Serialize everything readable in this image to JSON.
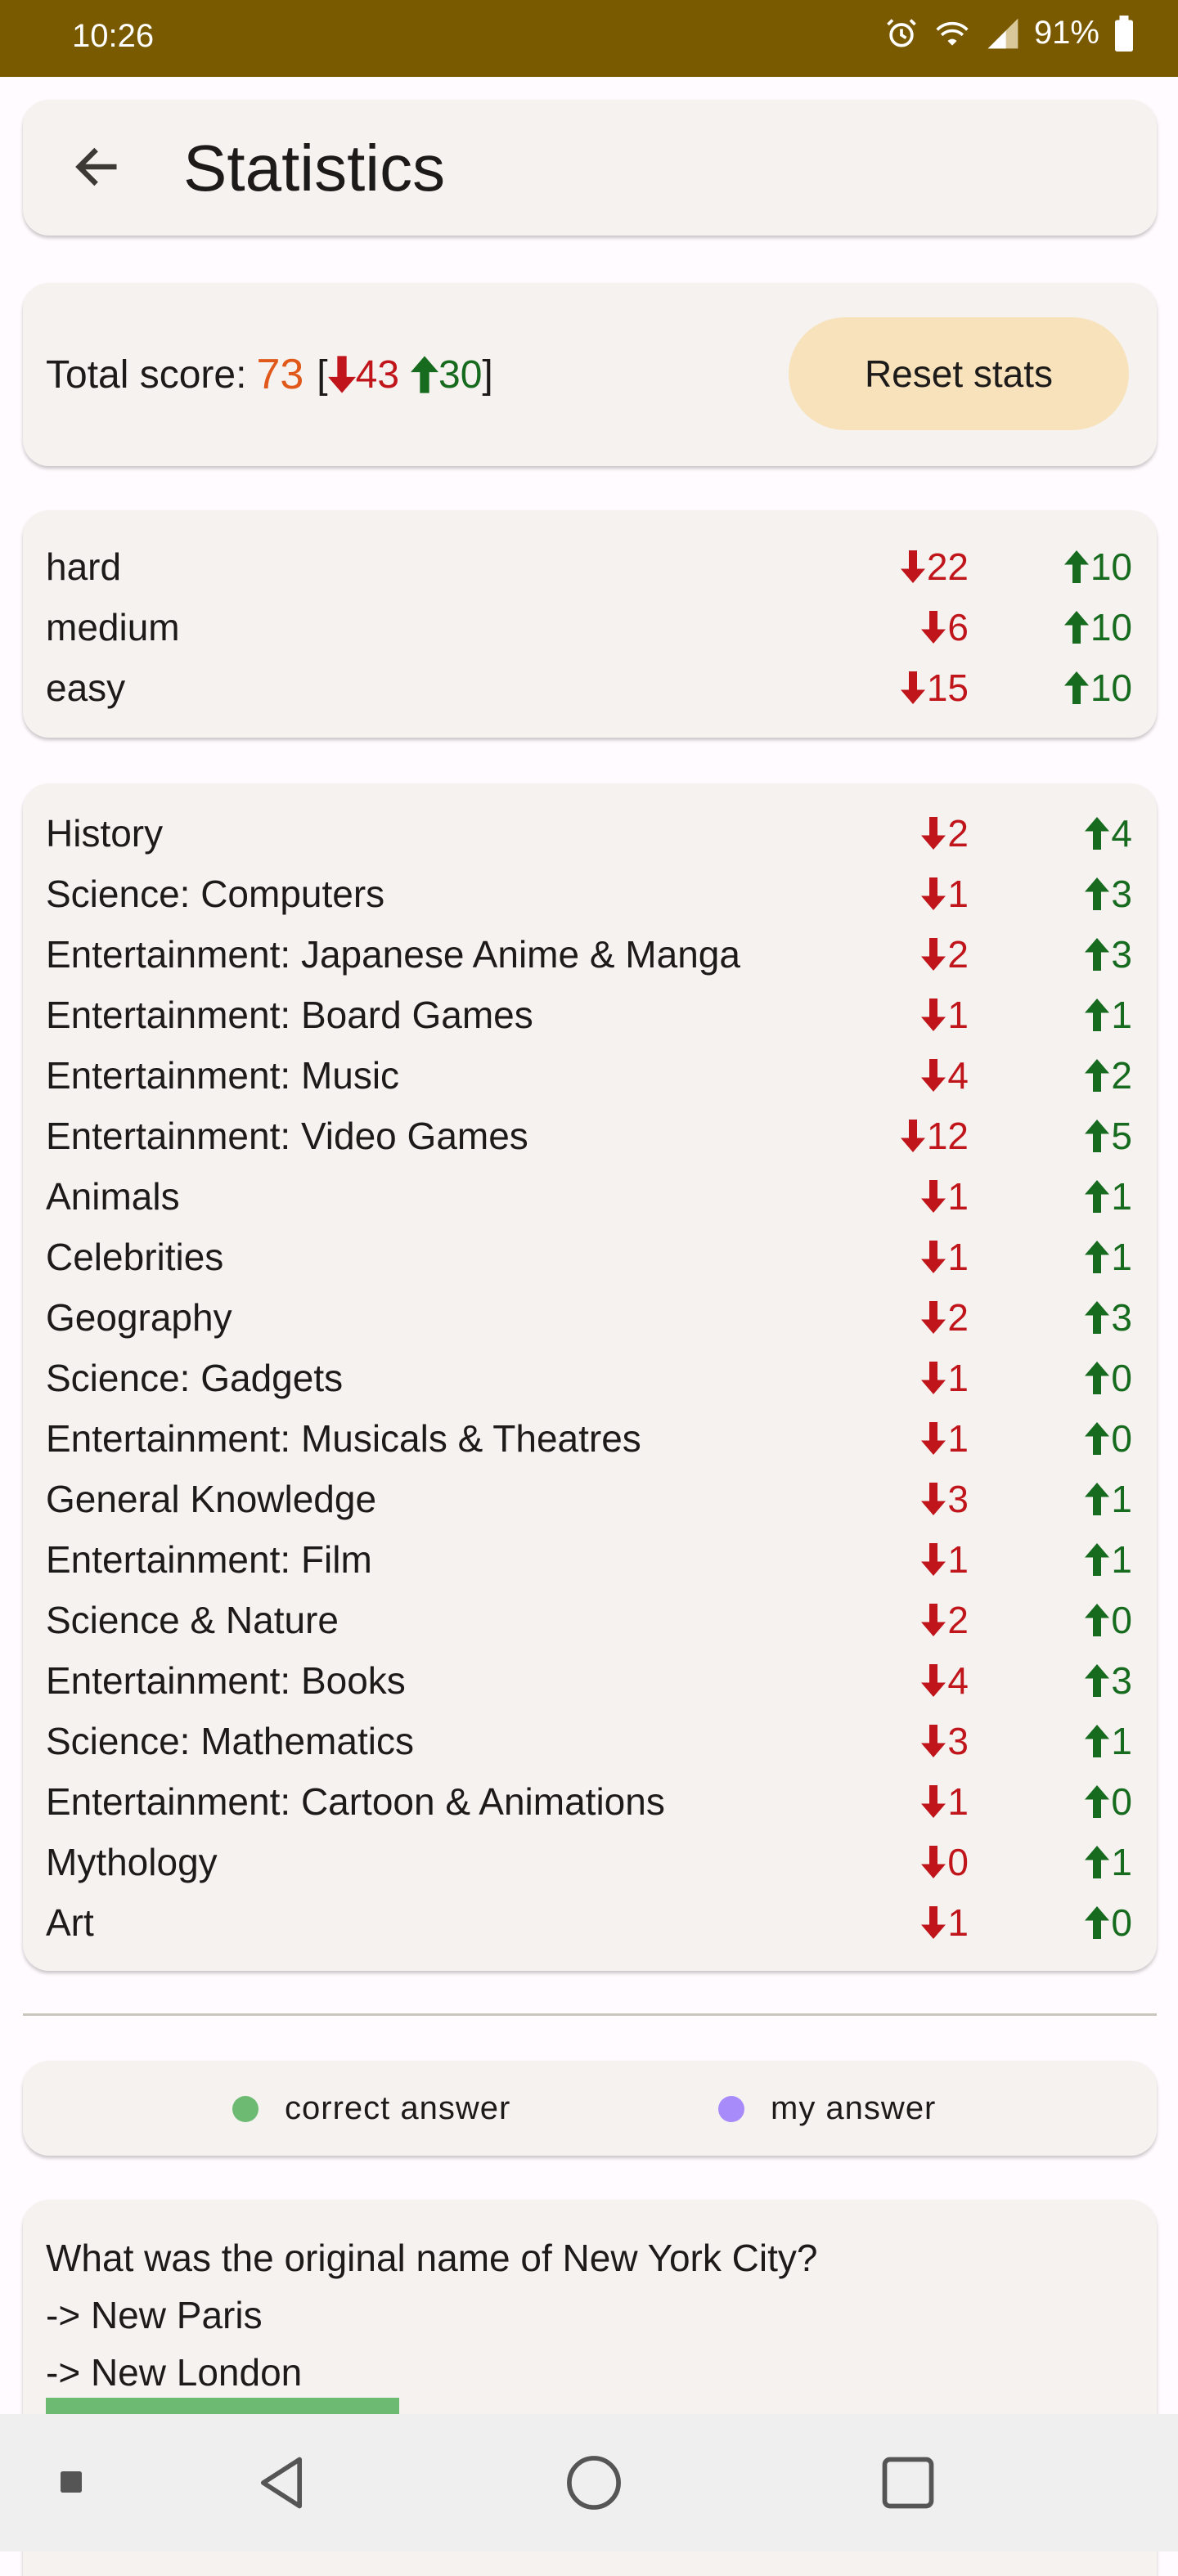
{
  "status_bar": {
    "time": "10:26",
    "battery": "91%"
  },
  "app_bar": {
    "title": "Statistics"
  },
  "score": {
    "label": "Total score:",
    "total": "73",
    "open_bracket": "[",
    "down": "43",
    "up": "30",
    "close_bracket": "]",
    "reset_label": "Reset stats"
  },
  "difficulty": [
    {
      "name": "hard",
      "down": "22",
      "up": "10"
    },
    {
      "name": "medium",
      "down": "6",
      "up": "10"
    },
    {
      "name": "easy",
      "down": "15",
      "up": "10"
    }
  ],
  "categories": [
    {
      "name": "History",
      "down": "2",
      "up": "4"
    },
    {
      "name": "Science: Computers",
      "down": "1",
      "up": "3"
    },
    {
      "name": "Entertainment: Japanese Anime & Manga",
      "down": "2",
      "up": "3"
    },
    {
      "name": "Entertainment: Board Games",
      "down": "1",
      "up": "1"
    },
    {
      "name": "Entertainment: Music",
      "down": "4",
      "up": "2"
    },
    {
      "name": "Entertainment: Video Games",
      "down": "12",
      "up": "5"
    },
    {
      "name": "Animals",
      "down": "1",
      "up": "1"
    },
    {
      "name": "Celebrities",
      "down": "1",
      "up": "1"
    },
    {
      "name": "Geography",
      "down": "2",
      "up": "3"
    },
    {
      "name": "Science: Gadgets",
      "down": "1",
      "up": "0"
    },
    {
      "name": "Entertainment: Musicals & Theatres",
      "down": "1",
      "up": "0"
    },
    {
      "name": "General Knowledge",
      "down": "3",
      "up": "1"
    },
    {
      "name": "Entertainment: Film",
      "down": "1",
      "up": "1"
    },
    {
      "name": "Science & Nature",
      "down": "2",
      "up": "0"
    },
    {
      "name": "Entertainment: Books",
      "down": "4",
      "up": "3"
    },
    {
      "name": "Science: Mathematics",
      "down": "3",
      "up": "1"
    },
    {
      "name": "Entertainment: Cartoon & Animations",
      "down": "1",
      "up": "0"
    },
    {
      "name": "Mythology",
      "down": "0",
      "up": "1"
    },
    {
      "name": "Art",
      "down": "1",
      "up": "0"
    }
  ],
  "legend": {
    "correct_label": "correct answer",
    "mine_label": "my answer",
    "correct_color": "#6dbb73",
    "mine_color": "#a78bfa"
  },
  "question": {
    "text": "What was the original name of New York City?",
    "options": [
      "-> New Paris",
      "-> New London"
    ]
  },
  "colors": {
    "down": "#c0151b",
    "up": "#176b1f",
    "total": "#e0591a",
    "accent": "#7a5a00"
  }
}
